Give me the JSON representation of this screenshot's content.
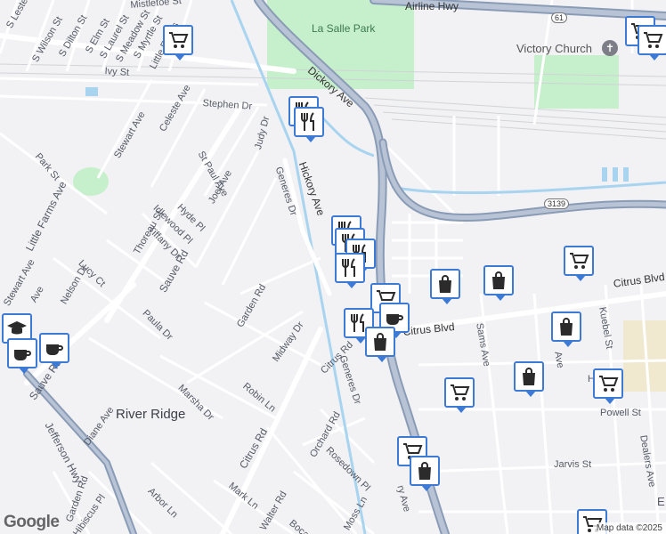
{
  "map": {
    "places": {
      "park": "La Salle Park",
      "church": "Victory Church",
      "area": "River Ridge"
    },
    "highways": {
      "airline": "Airline Hwy",
      "route61": "61",
      "route3139": "3139"
    },
    "streets": {
      "s_lester": "S Lester",
      "s_wilson": "S Wilson St",
      "s_dilton": "S Dilton St",
      "s_elm": "S Elm St",
      "s_laurel": "S Laurel St",
      "s_meadow": "S Meadow St",
      "s_myrtle": "S Myrtle St",
      "mistletoe": "Mistletoe St",
      "little_farms_top": "Little Farms",
      "ivy": "Ivy St",
      "stephen": "Stephen Dr",
      "celeste": "Celeste Ave",
      "stewart_top": "Stewart Ave",
      "judy": "Judy Dr",
      "park_st": "Park St",
      "st_paul": "St Paul Ave",
      "joel": "Joel Ave",
      "little_farms": "Little Farms Ave",
      "hyde": "Hyde Pl",
      "idlewood": "Idlewood Pl",
      "tiffany": "Tiffany Dr",
      "thoreau": "Thoreau St",
      "sauve_top": "Sauve Rd",
      "lucy": "Lucy Ct",
      "nelson": "Nelson Dr",
      "stewart_left": "Stewart Ave",
      "ave_left": "Ave",
      "paula": "Paula Dr",
      "garden_mid": "Garden Rd",
      "midway": "Midway Dr",
      "marsha": "Marsha Dr",
      "robin": "Robin Ln",
      "sauve_left": "Sauve Rd",
      "diane": "Diane Ave",
      "jefferson": "Jefferson Hwy",
      "citrus_left": "Citrus Rd",
      "citrus_rd2": "Citrus Rd",
      "orchard": "Orchard Rd",
      "rosedown": "Rosedown Pl",
      "arbor": "Arbor Ln",
      "mark": "Mark Ln",
      "walter": "Walter Rd",
      "boca": "Boca",
      "moss": "Moss Ln",
      "garden_left": "Garden Rd",
      "hibiscus": "Hibiscus Pl",
      "dickory": "Dickory Ave",
      "hickory": "Hickory Ave",
      "generes_top": "Generes Dr",
      "generes_mid": "Generes Dr",
      "citrus_blvd_right": "Citrus Blvd",
      "citrus_blvd_mid": "Citrus Blvd",
      "sams": "Sams Ave",
      "kuebel": "Kuebel St",
      "ave_mid": "Ave",
      "h_st": "H",
      "powell": "Powell St",
      "jarvis": "Jarvis St",
      "dealers": "Dealers Ave",
      "ry_ave": "ry Ave",
      "e_edge": "E"
    },
    "attribution": "Map data ©2025",
    "logo": "Google"
  },
  "markers": [
    {
      "icon": "cart-icon"
    },
    {
      "icon": "cart-icon"
    },
    {
      "icon": "restaurant-icon"
    },
    {
      "icon": "restaurant-icon"
    },
    {
      "icon": "restaurant-icon"
    },
    {
      "icon": "restaurant-icon"
    },
    {
      "icon": "restaurant-icon"
    },
    {
      "icon": "restaurant-icon"
    },
    {
      "icon": "shopping-bag-icon"
    },
    {
      "icon": "shopping-bag-icon"
    },
    {
      "icon": "cart-icon"
    },
    {
      "icon": "cart-icon"
    },
    {
      "icon": "restaurant-icon"
    },
    {
      "icon": "coffee-icon"
    },
    {
      "icon": "shopping-bag-icon"
    },
    {
      "icon": "shopping-bag-icon"
    },
    {
      "icon": "shopping-bag-icon"
    },
    {
      "icon": "cart-icon"
    },
    {
      "icon": "cart-icon"
    },
    {
      "icon": "school-icon"
    },
    {
      "icon": "coffee-icon"
    },
    {
      "icon": "coffee-icon"
    },
    {
      "icon": "cart-icon"
    },
    {
      "icon": "shopping-bag-icon"
    },
    {
      "icon": "cart-icon"
    }
  ]
}
